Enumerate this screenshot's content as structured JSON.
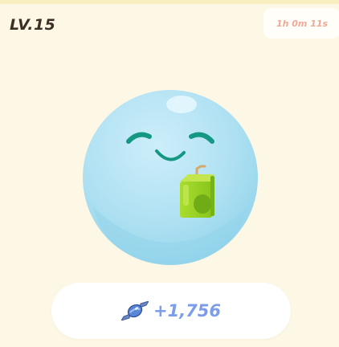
{
  "header": {
    "level": "LV.15",
    "timer": "1h 0m 11s"
  },
  "pet": {
    "name": "blue-bubble-pet",
    "held_item": "juice-box-icon",
    "expression": "happy-closed-eyes"
  },
  "reward": {
    "icon": "candy-icon",
    "amount": "+1,756"
  },
  "colors": {
    "background": "#fdf8e6",
    "pet_body": "#aee0f2",
    "face": "#149883",
    "juice_box": "#9bd323",
    "reward_text": "#7c9de9",
    "timer_text": "#f0a896"
  }
}
